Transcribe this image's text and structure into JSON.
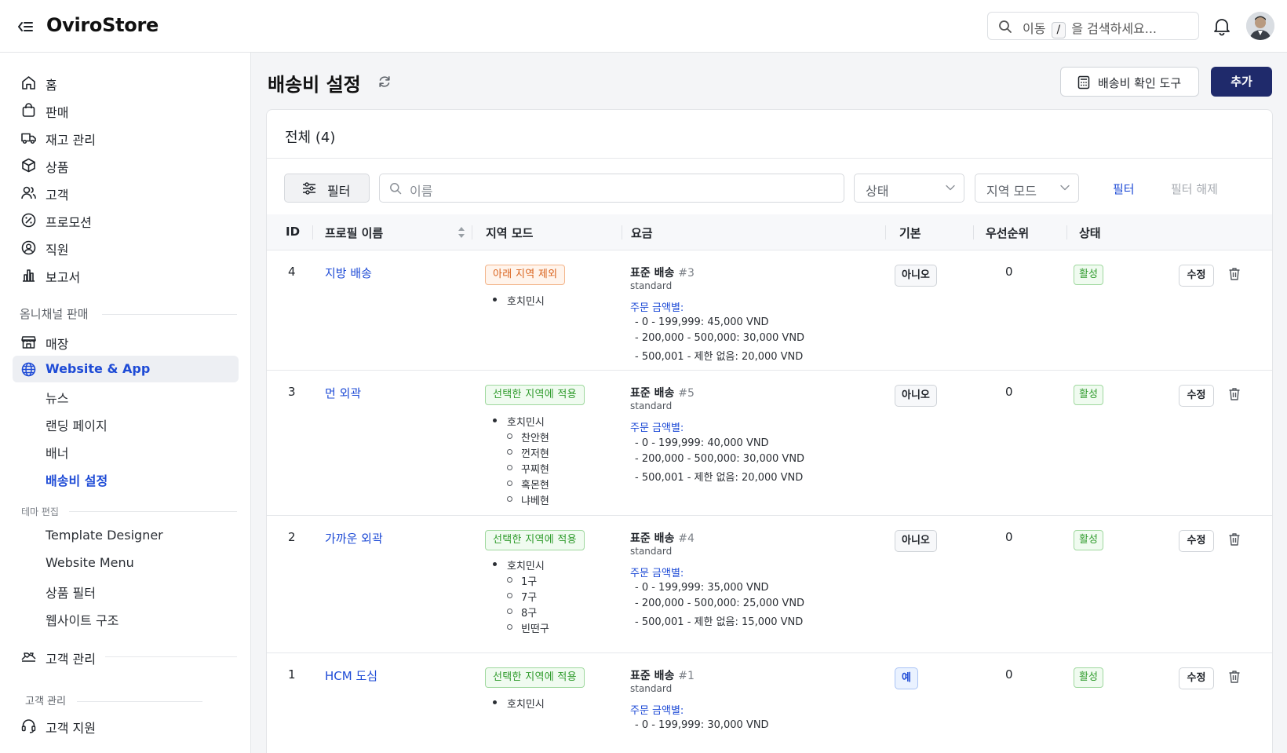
{
  "app": {
    "brand": "OviroStore"
  },
  "topbar": {
    "search_prefix": "이동",
    "search_key": "/",
    "search_suffix": "을 검색하세요..."
  },
  "sidebar": {
    "items": [
      {
        "label": "홈",
        "icon": "home-icon"
      },
      {
        "label": "판매",
        "icon": "shopping-bag-icon"
      },
      {
        "label": "재고 관리",
        "icon": "truck-icon"
      },
      {
        "label": "상품",
        "icon": "package-icon"
      },
      {
        "label": "고객",
        "icon": "users-icon"
      },
      {
        "label": "프로모션",
        "icon": "percent-badge-icon"
      },
      {
        "label": "직원",
        "icon": "staff-icon"
      },
      {
        "label": "보고서",
        "icon": "bar-chart-icon"
      }
    ],
    "omni_section": "옴니채널 판매",
    "store_label": "매장",
    "website_label": "Website & App",
    "website_subitems": [
      "뉴스",
      "랜딩 페이지",
      "배너",
      "배송비 설정"
    ],
    "theme_section": "테마 편집",
    "theme_subitems": [
      "Template Designer",
      "Website Menu",
      "상품 필터",
      "웹사이트 구조"
    ],
    "crm_label": "고객 관리",
    "crm_section": "고객 관리",
    "support_label": "고객 지원"
  },
  "page": {
    "title": "배송비 설정",
    "checker_button": "배송비 확인 도구",
    "add_button": "추가"
  },
  "card": {
    "title": "전체 (4)",
    "filter_button": "필터",
    "name_placeholder": "이름",
    "status_select": "상태",
    "region_mode_select": "지역 모드",
    "apply_filter": "필터",
    "clear_filter": "필터 해제"
  },
  "table": {
    "headers": {
      "id": "ID",
      "profile_name": "프로필 이름",
      "region_mode": "지역 모드",
      "fee": "요금",
      "default": "기본",
      "priority": "우선순위",
      "status": "상태"
    },
    "rows": [
      {
        "id": "4",
        "name": "지방 배송",
        "mode": "아래 지역 제외",
        "mode_color": "orange",
        "region": "호치민시",
        "districts": [],
        "fee_title": "표준 배송",
        "fee_number": "#3",
        "fee_code": "standard",
        "by_amount": "주문 금액별:",
        "tiers": [
          "- 0 - 199,999: 45,000 VND",
          "- 200,000 - 500,000: 30,000 VND",
          "- 500,001 - 제한 없음: 20,000 VND"
        ],
        "default": "아니오",
        "priority": "0",
        "status": "활성",
        "edit": "수정"
      },
      {
        "id": "3",
        "name": "먼 외곽",
        "mode": "선택한 지역에 적용",
        "mode_color": "green",
        "region": "호치민시",
        "districts": [
          "찬안현",
          "껀저현",
          "꾸찌현",
          "혹몬현",
          "냐베현"
        ],
        "fee_title": "표준 배송",
        "fee_number": "#5",
        "fee_code": "standard",
        "by_amount": "주문 금액별:",
        "tiers": [
          "- 0 - 199,999: 40,000 VND",
          "- 200,000 - 500,000: 30,000 VND",
          "- 500,001 - 제한 없음: 20,000 VND"
        ],
        "default": "아니오",
        "priority": "0",
        "status": "활성",
        "edit": "수정"
      },
      {
        "id": "2",
        "name": "가까운 외곽",
        "mode": "선택한 지역에 적용",
        "mode_color": "green",
        "region": "호치민시",
        "districts": [
          "1구",
          "7구",
          "8구",
          "빈떤구"
        ],
        "fee_title": "표준 배송",
        "fee_number": "#4",
        "fee_code": "standard",
        "by_amount": "주문 금액별:",
        "tiers": [
          "- 0 - 199,999: 35,000 VND",
          "- 200,000 - 500,000: 25,000 VND",
          "- 500,001 - 제한 없음: 15,000 VND"
        ],
        "default": "아니오",
        "priority": "0",
        "status": "활성",
        "edit": "수정"
      },
      {
        "id": "1",
        "name": "HCM 도심",
        "mode": "선택한 지역에 적용",
        "mode_color": "green",
        "region": "호치민시",
        "districts": [],
        "fee_title": "표준 배송",
        "fee_number": "#1",
        "fee_code": "standard",
        "by_amount": "주문 금액별:",
        "tiers": [
          "- 0 - 199,999: 30,000 VND"
        ],
        "default": "예",
        "priority": "0",
        "status": "활성",
        "edit": "수정"
      }
    ]
  }
}
